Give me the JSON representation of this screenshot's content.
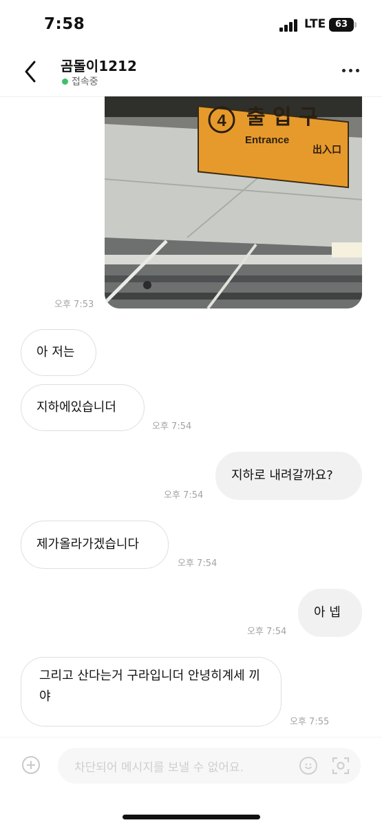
{
  "status_bar": {
    "time": "7:58",
    "network": "LTE",
    "battery": "63"
  },
  "header": {
    "title": "곰돌이1212",
    "status": "접속중"
  },
  "photo": {
    "sign_number": "4",
    "sign_korean": "출 입 구",
    "sign_english": "Entrance",
    "sign_hanja": "出入口",
    "time": "오후 7:53"
  },
  "messages": [
    {
      "text": "아 저는",
      "time": ""
    },
    {
      "text": "지하에있습니더",
      "time": "오후 7:54"
    },
    {
      "text": "지하로 내려갈까요?",
      "time": "오후 7:54"
    },
    {
      "text": "제가올라가겠습니다",
      "time": "오후 7:54"
    },
    {
      "text": "아 넵",
      "time": "오후 7:54"
    },
    {
      "text": "그리고 산다는거 구라입니더 안녕히계세 끼야",
      "time": "오후 7:55"
    }
  ],
  "input": {
    "placeholder": "차단되어 메시지를 보낼 수 없어요."
  },
  "colors": {
    "online_dot": "#3fbf6b",
    "outgoing_bubble": "#f1f1f1",
    "sign_background": "#e79a2c"
  }
}
